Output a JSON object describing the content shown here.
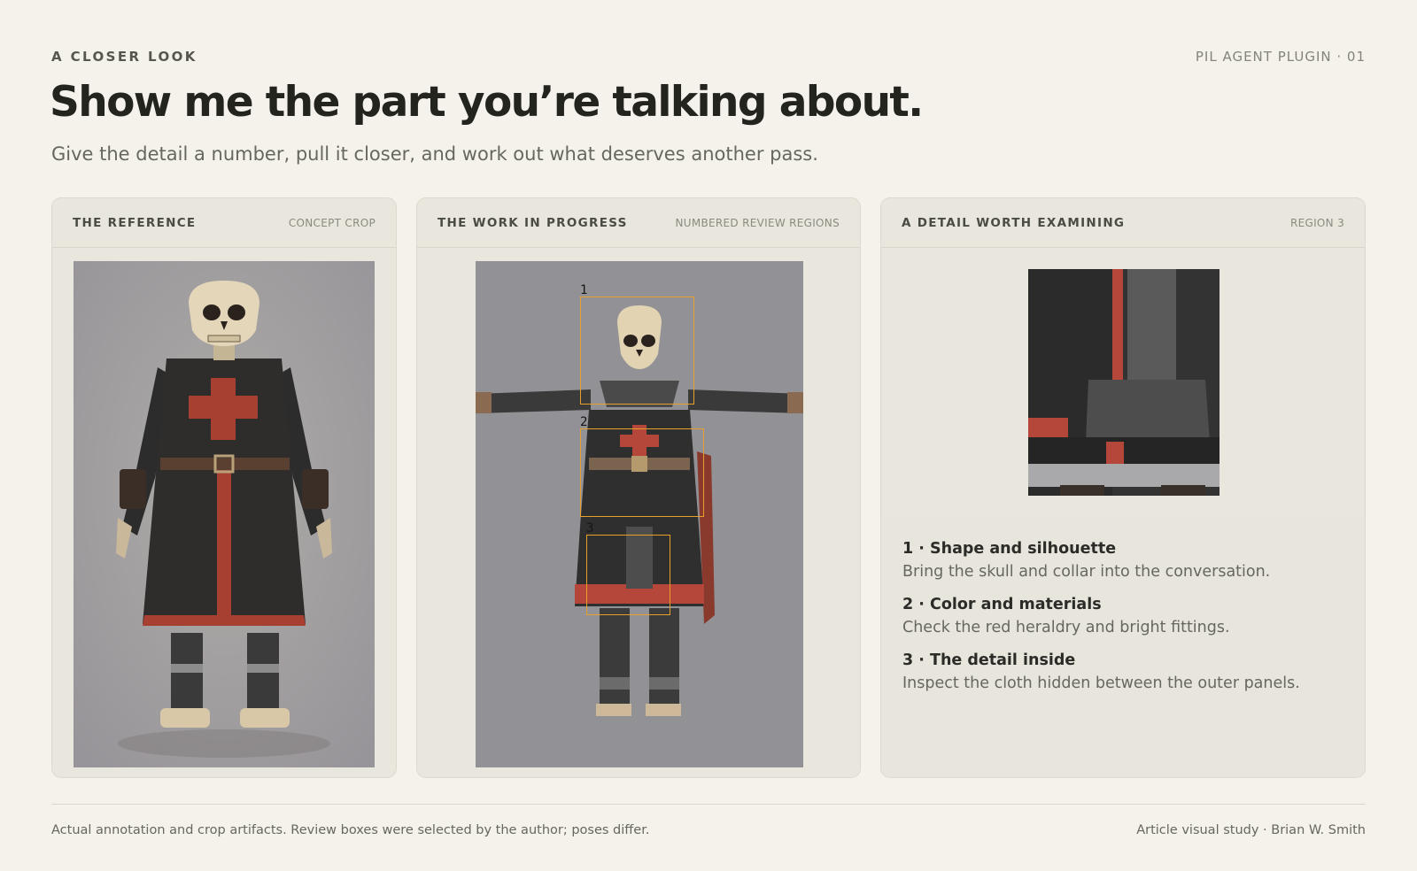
{
  "header": {
    "eyebrow": "A CLOSER LOOK",
    "series": "PIL AGENT PLUGIN · 01",
    "title": "Show me the part you’re talking about.",
    "subtitle": "Give the detail a number, pull it closer, and work out what deserves another pass."
  },
  "cards": [
    {
      "title": "THE REFERENCE",
      "tag": "CONCEPT CROP"
    },
    {
      "title": "THE WORK IN PROGRESS",
      "tag": "NUMBERED REVIEW REGIONS"
    },
    {
      "title": "A DETAIL WORTH EXAMINING",
      "tag": "REGION 3"
    }
  ],
  "regions": [
    "1",
    "2",
    "3"
  ],
  "notes": [
    {
      "heading": "1 · Shape and silhouette",
      "body": "Bring the skull and collar into the conversation."
    },
    {
      "heading": "2 · Color and materials",
      "body": "Check the red heraldry and bright fittings."
    },
    {
      "heading": "3 · The detail inside",
      "body": "Inspect the cloth hidden between the outer panels."
    }
  ],
  "footer": {
    "caption": "Actual annotation and crop artifacts. Review boxes were selected by the author; poses differ.",
    "credit": "Article visual study · Brian W. Smith"
  },
  "colors": {
    "page_bg": "#f4f2ea",
    "card_bg": "#e9e7dd",
    "region_box": "#e8a02a",
    "tunic_red": "#b5473a"
  },
  "icons": [
    "skeleton-knight-reference-image",
    "skeleton-knight-wip-image",
    "cloth-detail-crop-image"
  ]
}
